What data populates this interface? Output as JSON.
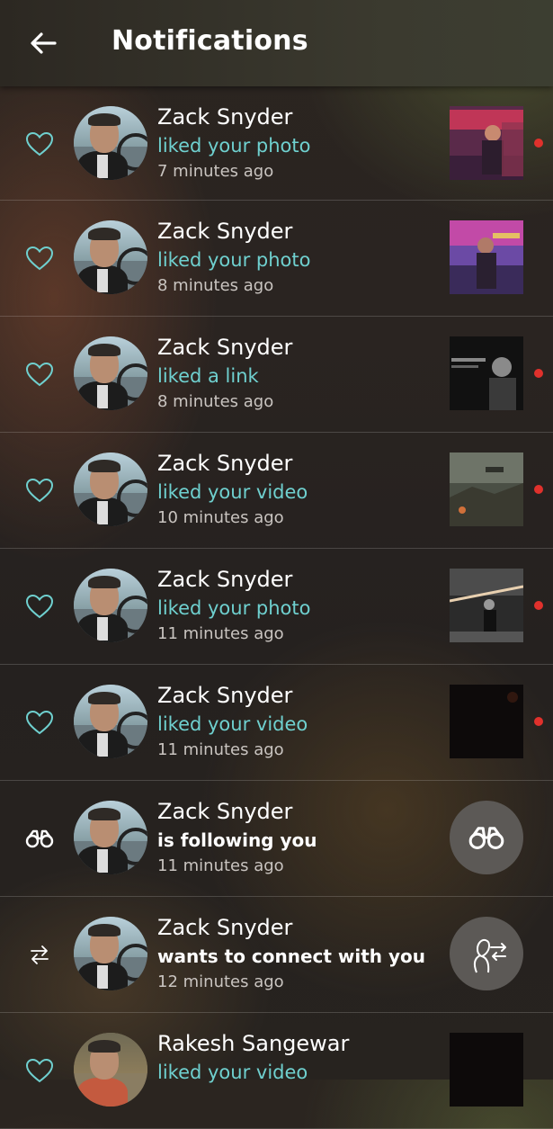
{
  "header": {
    "title": "Notifications"
  },
  "notifications": [
    {
      "name": "Zack Snyder",
      "action": "liked your photo",
      "time": "7 minutes ago",
      "type": "like",
      "unread": true
    },
    {
      "name": "Zack Snyder",
      "action": "liked your photo",
      "time": "8 minutes ago",
      "type": "like",
      "unread": false
    },
    {
      "name": "Zack Snyder",
      "action": "liked a link",
      "time": "8 minutes ago",
      "type": "like",
      "unread": true
    },
    {
      "name": "Zack Snyder",
      "action": "liked your video",
      "time": "10 minutes ago",
      "type": "like",
      "unread": true
    },
    {
      "name": "Zack Snyder",
      "action": "liked your photo",
      "time": "11 minutes ago",
      "type": "like",
      "unread": true
    },
    {
      "name": "Zack Snyder",
      "action": "liked your video",
      "time": "11 minutes ago",
      "type": "like",
      "unread": true
    },
    {
      "name": "Zack Snyder",
      "action": "is following you",
      "time": "11 minutes ago",
      "type": "follow",
      "unread": false
    },
    {
      "name": "Zack Snyder",
      "action": "wants to connect with you",
      "time": "12 minutes ago",
      "type": "connect",
      "unread": false
    },
    {
      "name": "Rakesh Sangewar",
      "action": "liked your video",
      "time": "",
      "type": "like",
      "unread": false
    }
  ],
  "icons": {
    "back": "arrow-left-icon",
    "like": "heart-outline-icon",
    "follow": "binoculars-icon",
    "connect": "swap-arrows-icon"
  },
  "colors": {
    "accent": "#6fd0cf",
    "unread": "#e0312c",
    "header_bg": "#3b3a2f"
  }
}
